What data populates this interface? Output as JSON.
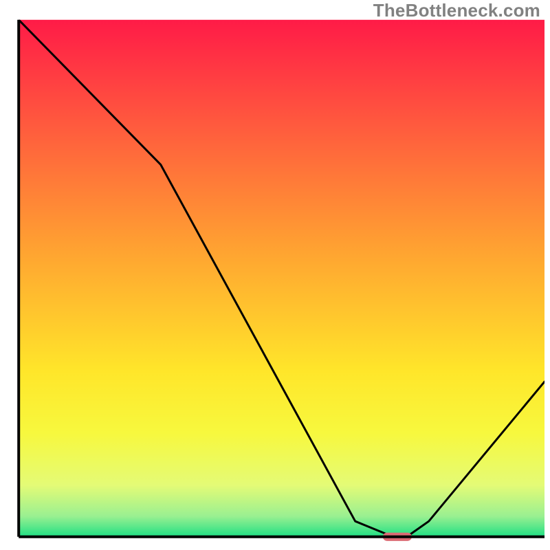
{
  "watermark": "TheBottleneck.com",
  "chart_data": {
    "type": "line",
    "title": "",
    "xlabel": "",
    "ylabel": "",
    "xlim": [
      0,
      100
    ],
    "ylim": [
      0,
      100
    ],
    "note": "Axis values are image-space percentages; no numeric tick labels or axis annotations are present in the original figure. Curve values are read off the plotted line relative to the visible plot area.",
    "series": [
      {
        "name": "bottleneck-curve",
        "color": "#000000",
        "x": [
          0,
          27,
          64,
          70,
          74.5,
          78,
          100
        ],
        "y": [
          100,
          72,
          3,
          0.5,
          0.5,
          3,
          30
        ]
      }
    ],
    "marker": {
      "name": "optimal-point",
      "color": "#db6b74",
      "x": 72,
      "y": 0,
      "width_pct": 5.5,
      "height_pct": 1.6
    },
    "gradient_stops": [
      {
        "offset": 0.0,
        "color": "#ff1b47"
      },
      {
        "offset": 0.2,
        "color": "#ff593e"
      },
      {
        "offset": 0.45,
        "color": "#ffa431"
      },
      {
        "offset": 0.68,
        "color": "#ffe62a"
      },
      {
        "offset": 0.8,
        "color": "#f7f83e"
      },
      {
        "offset": 0.9,
        "color": "#e4fb76"
      },
      {
        "offset": 0.96,
        "color": "#9af091"
      },
      {
        "offset": 1.0,
        "color": "#1fdf84"
      }
    ],
    "axes": {
      "color": "#000000",
      "stroke_width": 4,
      "x0_pct": 3.4,
      "x1_pct": 99.0,
      "y0_pct": 3.6,
      "y1_pct": 97.6
    }
  }
}
